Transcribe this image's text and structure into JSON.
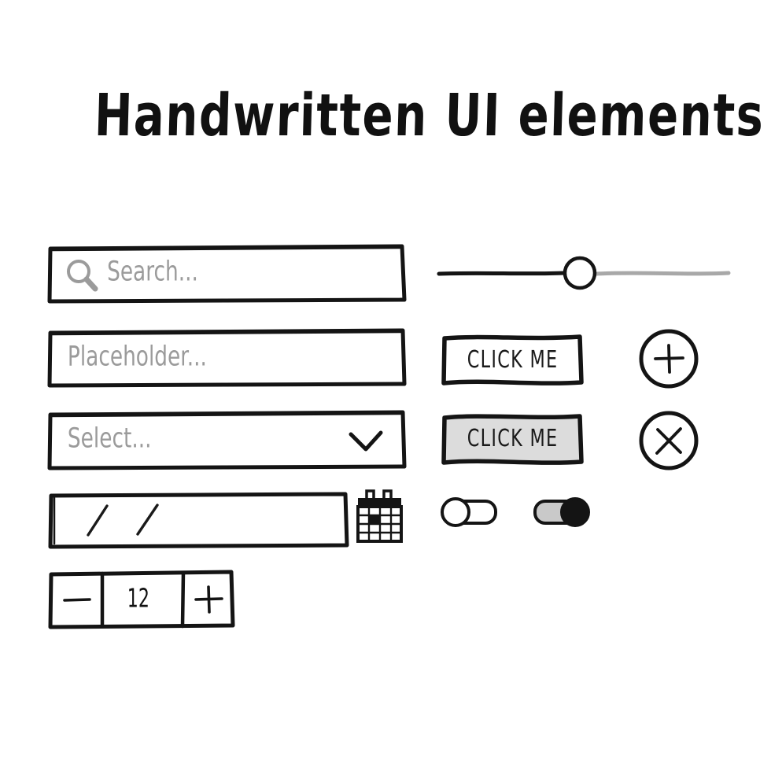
{
  "page": {
    "title": "Handwritten UI elements",
    "background_color": "#ffffff",
    "ink_color": "#141414",
    "placeholder_color": "#9b9b9b",
    "fill_gray": "#dcdcdc",
    "track_gray": "#a8a8a8"
  },
  "search_field": {
    "name": "search",
    "placeholder": "Search...",
    "value": "",
    "icon": "search-icon"
  },
  "text_field": {
    "name": "text-input",
    "placeholder": "Placeholder...",
    "value": ""
  },
  "select_field": {
    "name": "select",
    "placeholder": "Select...",
    "value": "",
    "icon": "chevron-down-icon"
  },
  "date_field": {
    "name": "date-input",
    "value": "/    /",
    "separator": "/",
    "icon": "calendar-icon"
  },
  "stepper": {
    "decrement_label": "−",
    "value": "12",
    "increment_label": "+"
  },
  "slider": {
    "value_percent": 50,
    "filled_color": "#141414",
    "empty_color": "#a8a8a8",
    "knob_fill": "#ffffff"
  },
  "buttons": [
    {
      "label": "CLICK ME",
      "state": "default",
      "fill": "#ffffff"
    },
    {
      "label": "CLICK ME",
      "state": "active",
      "fill": "#dcdcdc"
    }
  ],
  "icon_buttons": [
    {
      "icon": "plus-icon",
      "label": "+",
      "shape": "circle"
    },
    {
      "icon": "close-icon",
      "label": "×",
      "shape": "circle"
    }
  ],
  "toggles": [
    {
      "state": "off",
      "knob_position": "left",
      "knob_fill": "#ffffff",
      "track_fill": "#ffffff"
    },
    {
      "state": "on",
      "knob_position": "right",
      "knob_fill": "#141414",
      "track_fill": "#c9c9c9"
    }
  ]
}
